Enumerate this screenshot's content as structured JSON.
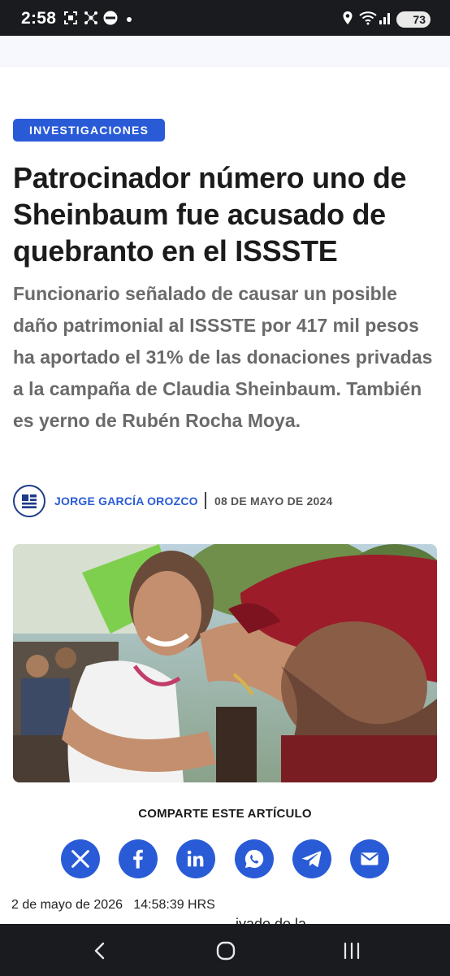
{
  "status_bar": {
    "time": "2:58",
    "battery_level": "73",
    "icons": [
      "screenshot-icon",
      "network-icon",
      "weather-app-icon",
      "location-icon",
      "wifi-icon",
      "signal-icon"
    ]
  },
  "article": {
    "category": "INVESTIGACIONES",
    "headline": "Patrocinador número uno de Sheinbaum fue acusado de quebranto en el ISSSTE",
    "subheadline": "Funcionario señalado de causar un posible daño patrimonial al ISSSTE por 417 mil pesos ha aportado el 31% de las donaciones privadas a la campaña de Claudia Sheinbaum. También es yerno de Rubén Rocha Moya.",
    "author": "JORGE GARCÍA OROZCO",
    "date": "08 DE MAYO DE 2024",
    "share_title": "COMPARTE ESTE ARTÍCULO",
    "share_buttons": [
      "x-icon",
      "facebook-icon",
      "linkedin-icon",
      "whatsapp-icon",
      "telegram-icon",
      "email-icon"
    ],
    "partial_line": "iyado de la"
  },
  "overlay": {
    "timestamp": "2 de mayo de 2026   14:58:39 HRS"
  },
  "colors": {
    "accent": "#2a5bd7",
    "status_bar": "#1a1b1f",
    "headline": "#1b1b1b",
    "subheadline": "#6a6a6a"
  }
}
